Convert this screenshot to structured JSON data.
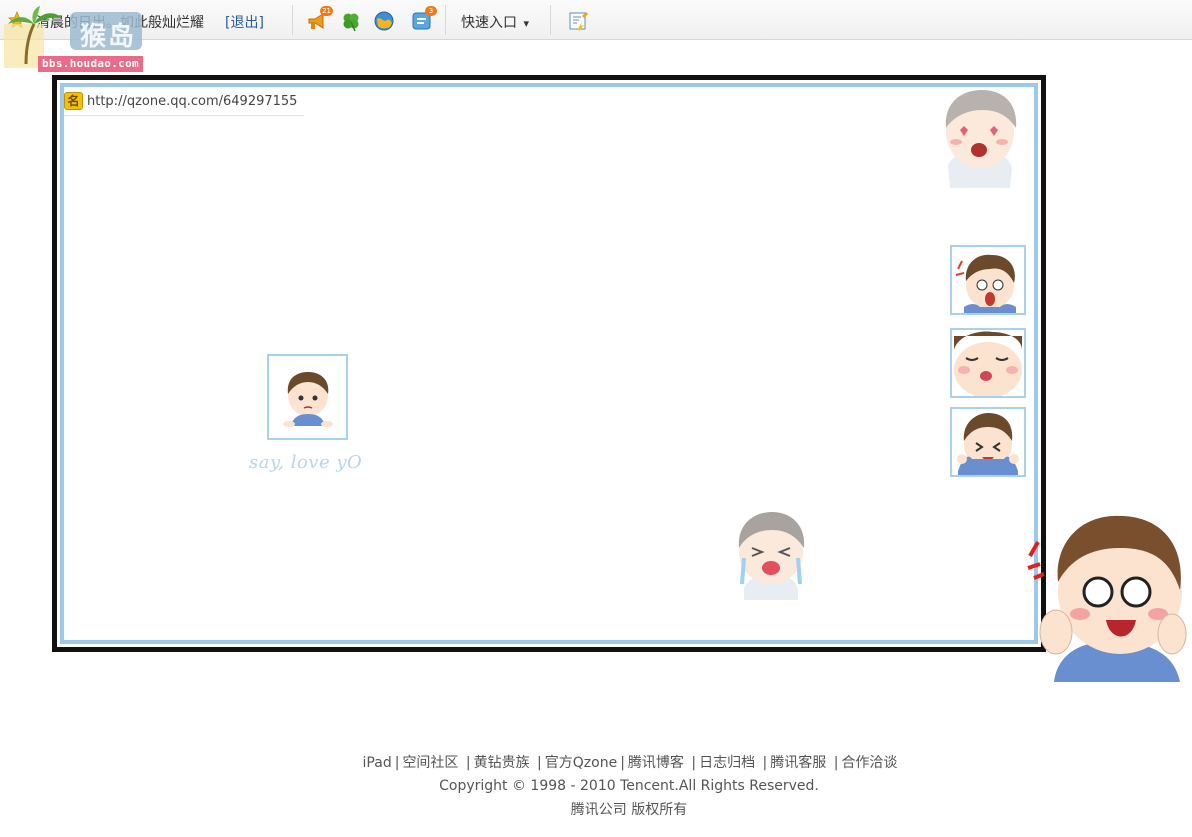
{
  "toolbar": {
    "status_text": "清晨的日出。如此般灿烂耀",
    "logout_label": "[退出]",
    "notify_badge": "21",
    "message_badge": "3",
    "quick_entry_label": "快速入口",
    "quick_entry_arrow": "▾"
  },
  "watermark": {
    "logo_text": "猴岛",
    "url": "bbs.houdao.com"
  },
  "panel": {
    "name_badge": "名",
    "url": "http://qzone.qq.com/649297155",
    "caption": "say, love yO"
  },
  "footer": {
    "links": [
      "iPad",
      "空间社区",
      "黄钻贵族",
      "官方Qzone",
      "腾讯博客",
      "日志归档",
      "腾讯客服",
      "合作洽谈"
    ],
    "copyright": "Copyright © 1998 - 2010 Tencent.All Rights Reserved.",
    "rights": "腾讯公司  版权所有"
  },
  "colors": {
    "frame_border": "#111111",
    "frame_inner": "#9cc8ea",
    "link_blue": "#2a5d9f",
    "badge_orange": "#f07a16"
  }
}
